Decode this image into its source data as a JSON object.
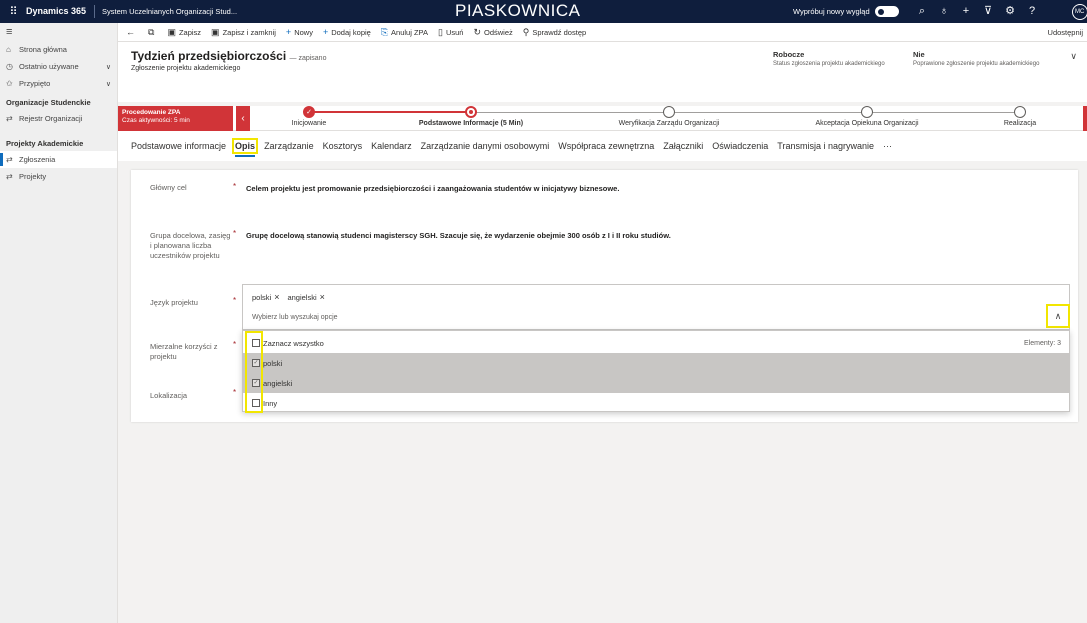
{
  "topbar": {
    "waffle": "⠿",
    "brand": "Dynamics 365",
    "app_name": "System Uczelnianych Organizacji Stud...",
    "environment": "PIASKOWNICA",
    "try_new_look": "Wypróbuj nowy wygląd",
    "avatar": "MC"
  },
  "sidebar": {
    "items_top": [
      {
        "icon": "⌂",
        "label": "Strona główna"
      },
      {
        "icon": "◷",
        "label": "Ostatnio używane",
        "chevron": "∨"
      },
      {
        "icon": "✩",
        "label": "Przypięto",
        "chevron": "∨"
      }
    ],
    "group1": "Organizacje Studenckie",
    "group1_items": [
      {
        "icon": "⇄",
        "label": "Rejestr Organizacji"
      }
    ],
    "group2": "Projekty Akademickie",
    "group2_items": [
      {
        "icon": "⇄",
        "label": "Zgłoszenia"
      },
      {
        "icon": "⇄",
        "label": "Projekty"
      }
    ]
  },
  "commandbar": {
    "back": "←",
    "popout": "⧉",
    "save": "Zapisz",
    "save_close": "Zapisz i zamknij",
    "new": "Nowy",
    "copy": "Dodaj kopię",
    "cancel_zpa": "Anuluj ZPA",
    "delete": "Usuń",
    "refresh": "Odśwież",
    "check_access": "Sprawdź dostęp",
    "share": "Udostępnij"
  },
  "header": {
    "title": "Tydzień przedsiębiorczości",
    "saved": "— zapisano",
    "subtitle": "Zgłoszenie projektu akademickiego",
    "status_value": "Robocze",
    "status_label": "Status zgłoszenia projektu akademickiego",
    "corrected_value": "Nie",
    "corrected_label": "Poprawione zgłoszenie projektu akademickiego"
  },
  "process": {
    "name": "Procedowanie ZPA",
    "time": "Czas aktywności: 5 min",
    "stages": [
      {
        "label": "Inicjowanie",
        "state": "done"
      },
      {
        "label": "Podstawowe Informacje  (5 Min)",
        "state": "active"
      },
      {
        "label": "Weryfikacja Zarządu Organizacji",
        "state": "pending"
      },
      {
        "label": "Akceptacja Opiekuna Organizacji",
        "state": "pending"
      },
      {
        "label": "Realizacja",
        "state": "pending"
      }
    ]
  },
  "tabs": [
    "Podstawowe informacje",
    "Opis",
    "Zarządzanie",
    "Kosztorys",
    "Kalendarz",
    "Zarządzanie danymi osobowymi",
    "Współpraca zewnętrzna",
    "Załączniki",
    "Oświadczenia",
    "Transmisja i nagrywanie",
    "···"
  ],
  "selected_tab": "Opis",
  "form": {
    "goal_label": "Główny cel",
    "goal_value": "Celem projektu jest promowanie przedsiębiorczości i zaangażowania studentów w inicjatywy biznesowe.",
    "group_label": "Grupa docelowa, zasięg i planowana liczba uczestników projektu",
    "group_value": "Grupę docelową stanowią studenci magisterscy SGH. Szacuje się, że wydarzenie obejmie 300 osób z I i II roku studiów.",
    "language_label": "Język projektu",
    "language_tags": [
      "polski",
      "angielski"
    ],
    "language_placeholder": "Wybierz lub wyszukaj opcje",
    "benefits_label": "Mierzalne korzyści z projektu",
    "location_label": "Lokalizacja",
    "required_mark": "*"
  },
  "dropdown": {
    "select_all": "Zaznacz wszystko",
    "count": "Elementy: 3",
    "options": [
      {
        "label": "polski",
        "checked": true
      },
      {
        "label": "angielski",
        "checked": true
      },
      {
        "label": "Inny",
        "checked": false
      }
    ]
  }
}
